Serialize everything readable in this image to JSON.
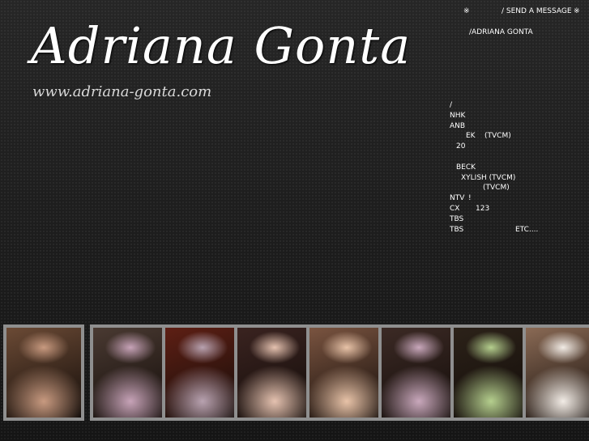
{
  "header": {
    "title": "Adriana Gonta",
    "url": "www.adriana-gonta.com"
  },
  "nav": {
    "mark_left": "※",
    "send_message": "/ SEND A MESSAGE",
    "mark_right": "※",
    "profile": "/ADRIANA GONTA"
  },
  "works": [
    {
      "a": "/",
      "b": "",
      "c": ""
    },
    {
      "a": "NHK",
      "b": "",
      "c": ""
    },
    {
      "a": "ANB",
      "b": "",
      "c": ""
    },
    {
      "a": "",
      "b": "EK",
      "c": "(TVCM)"
    },
    {
      "a": "",
      "b": "20",
      "c": ""
    },
    {
      "a": "",
      "b": "",
      "c": ""
    },
    {
      "a": "",
      "b": "BECK",
      "c": ""
    },
    {
      "a": "",
      "b": "XYLISH (TVCM)",
      "c": ""
    },
    {
      "a": "",
      "b": "",
      "c": "(TVCM)"
    },
    {
      "a": "NTV",
      "b": "!",
      "c": ""
    },
    {
      "a": "CX",
      "b": "123",
      "c": ""
    },
    {
      "a": "TBS",
      "b": "",
      "c": ""
    },
    {
      "a": "TBS",
      "b": "",
      "c": "ETC...."
    }
  ],
  "gallery": [
    {
      "name": "photo-statue-kiss",
      "bg": "#6b4a35",
      "accent": "#c89a80"
    },
    {
      "name": "photo-pink-gown",
      "bg": "#4a3a32",
      "accent": "#c7a3b8"
    },
    {
      "name": "photo-gown-red-room",
      "bg": "#5e1f14",
      "accent": "#b8a2b0"
    },
    {
      "name": "photo-flower-portrait",
      "bg": "#3a2320",
      "accent": "#e5c2b0"
    },
    {
      "name": "photo-closeup-portrait",
      "bg": "#7a5440",
      "accent": "#e8c3a8"
    },
    {
      "name": "photo-pink-gown-2",
      "bg": "#3c2a25",
      "accent": "#c9a8bc"
    },
    {
      "name": "photo-green-gown",
      "bg": "#2c2219",
      "accent": "#b5cf8e"
    },
    {
      "name": "photo-white-gown-stairs",
      "bg": "#8a6a55",
      "accent": "#f2ece6"
    }
  ]
}
